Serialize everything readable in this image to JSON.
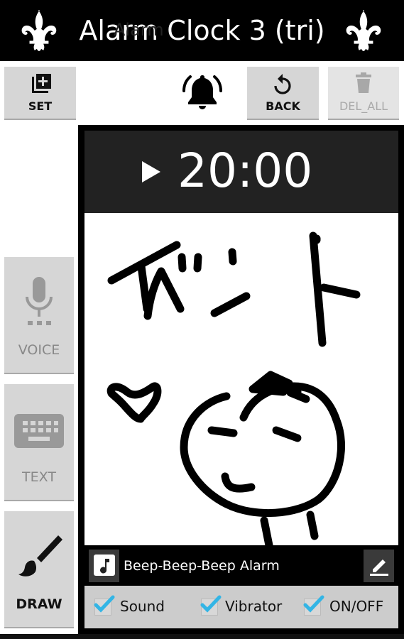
{
  "header": {
    "title": "Alarm Clock 3 (tri)",
    "left_icon": "fleur-de-lis-icon",
    "right_icon": "fleur-de-lis-icon"
  },
  "toolbar": {
    "set_label": "SET",
    "set_icon": "add-to-queue-icon",
    "alarm_label": "Alarm",
    "alarm_icon": "ringing-bell-icon",
    "back_label": "BACK",
    "back_icon": "undo-icon",
    "del_all_label": "DEL_ALL",
    "del_all_icon": "trash-icon",
    "del_all_enabled": false
  },
  "side_buttons": [
    {
      "label": "VOICE",
      "icon": "microphone-icon",
      "enabled": false
    },
    {
      "label": "TEXT",
      "icon": "keyboard-icon",
      "enabled": false
    },
    {
      "label": "DRAW",
      "icon": "paintbrush-icon",
      "enabled": true
    }
  ],
  "alarm": {
    "time": "20:00",
    "play_icon": "play-icon",
    "drawing_text": "イベント",
    "sound_icon": "music-note-icon",
    "sound_name": "Beep-Beep-Beep Alarm",
    "edit_icon": "edit-pencil-icon"
  },
  "options": [
    {
      "label": "Sound",
      "checked": true
    },
    {
      "label": "Vibrator",
      "checked": true
    },
    {
      "label": "ON/OFF",
      "checked": true
    }
  ],
  "colors": {
    "header_bg": "#000000",
    "button_bg": "#d6d6d6",
    "time_bar_bg": "#222222",
    "check_accent": "#33b5e5",
    "options_bg": "#cccccc"
  }
}
